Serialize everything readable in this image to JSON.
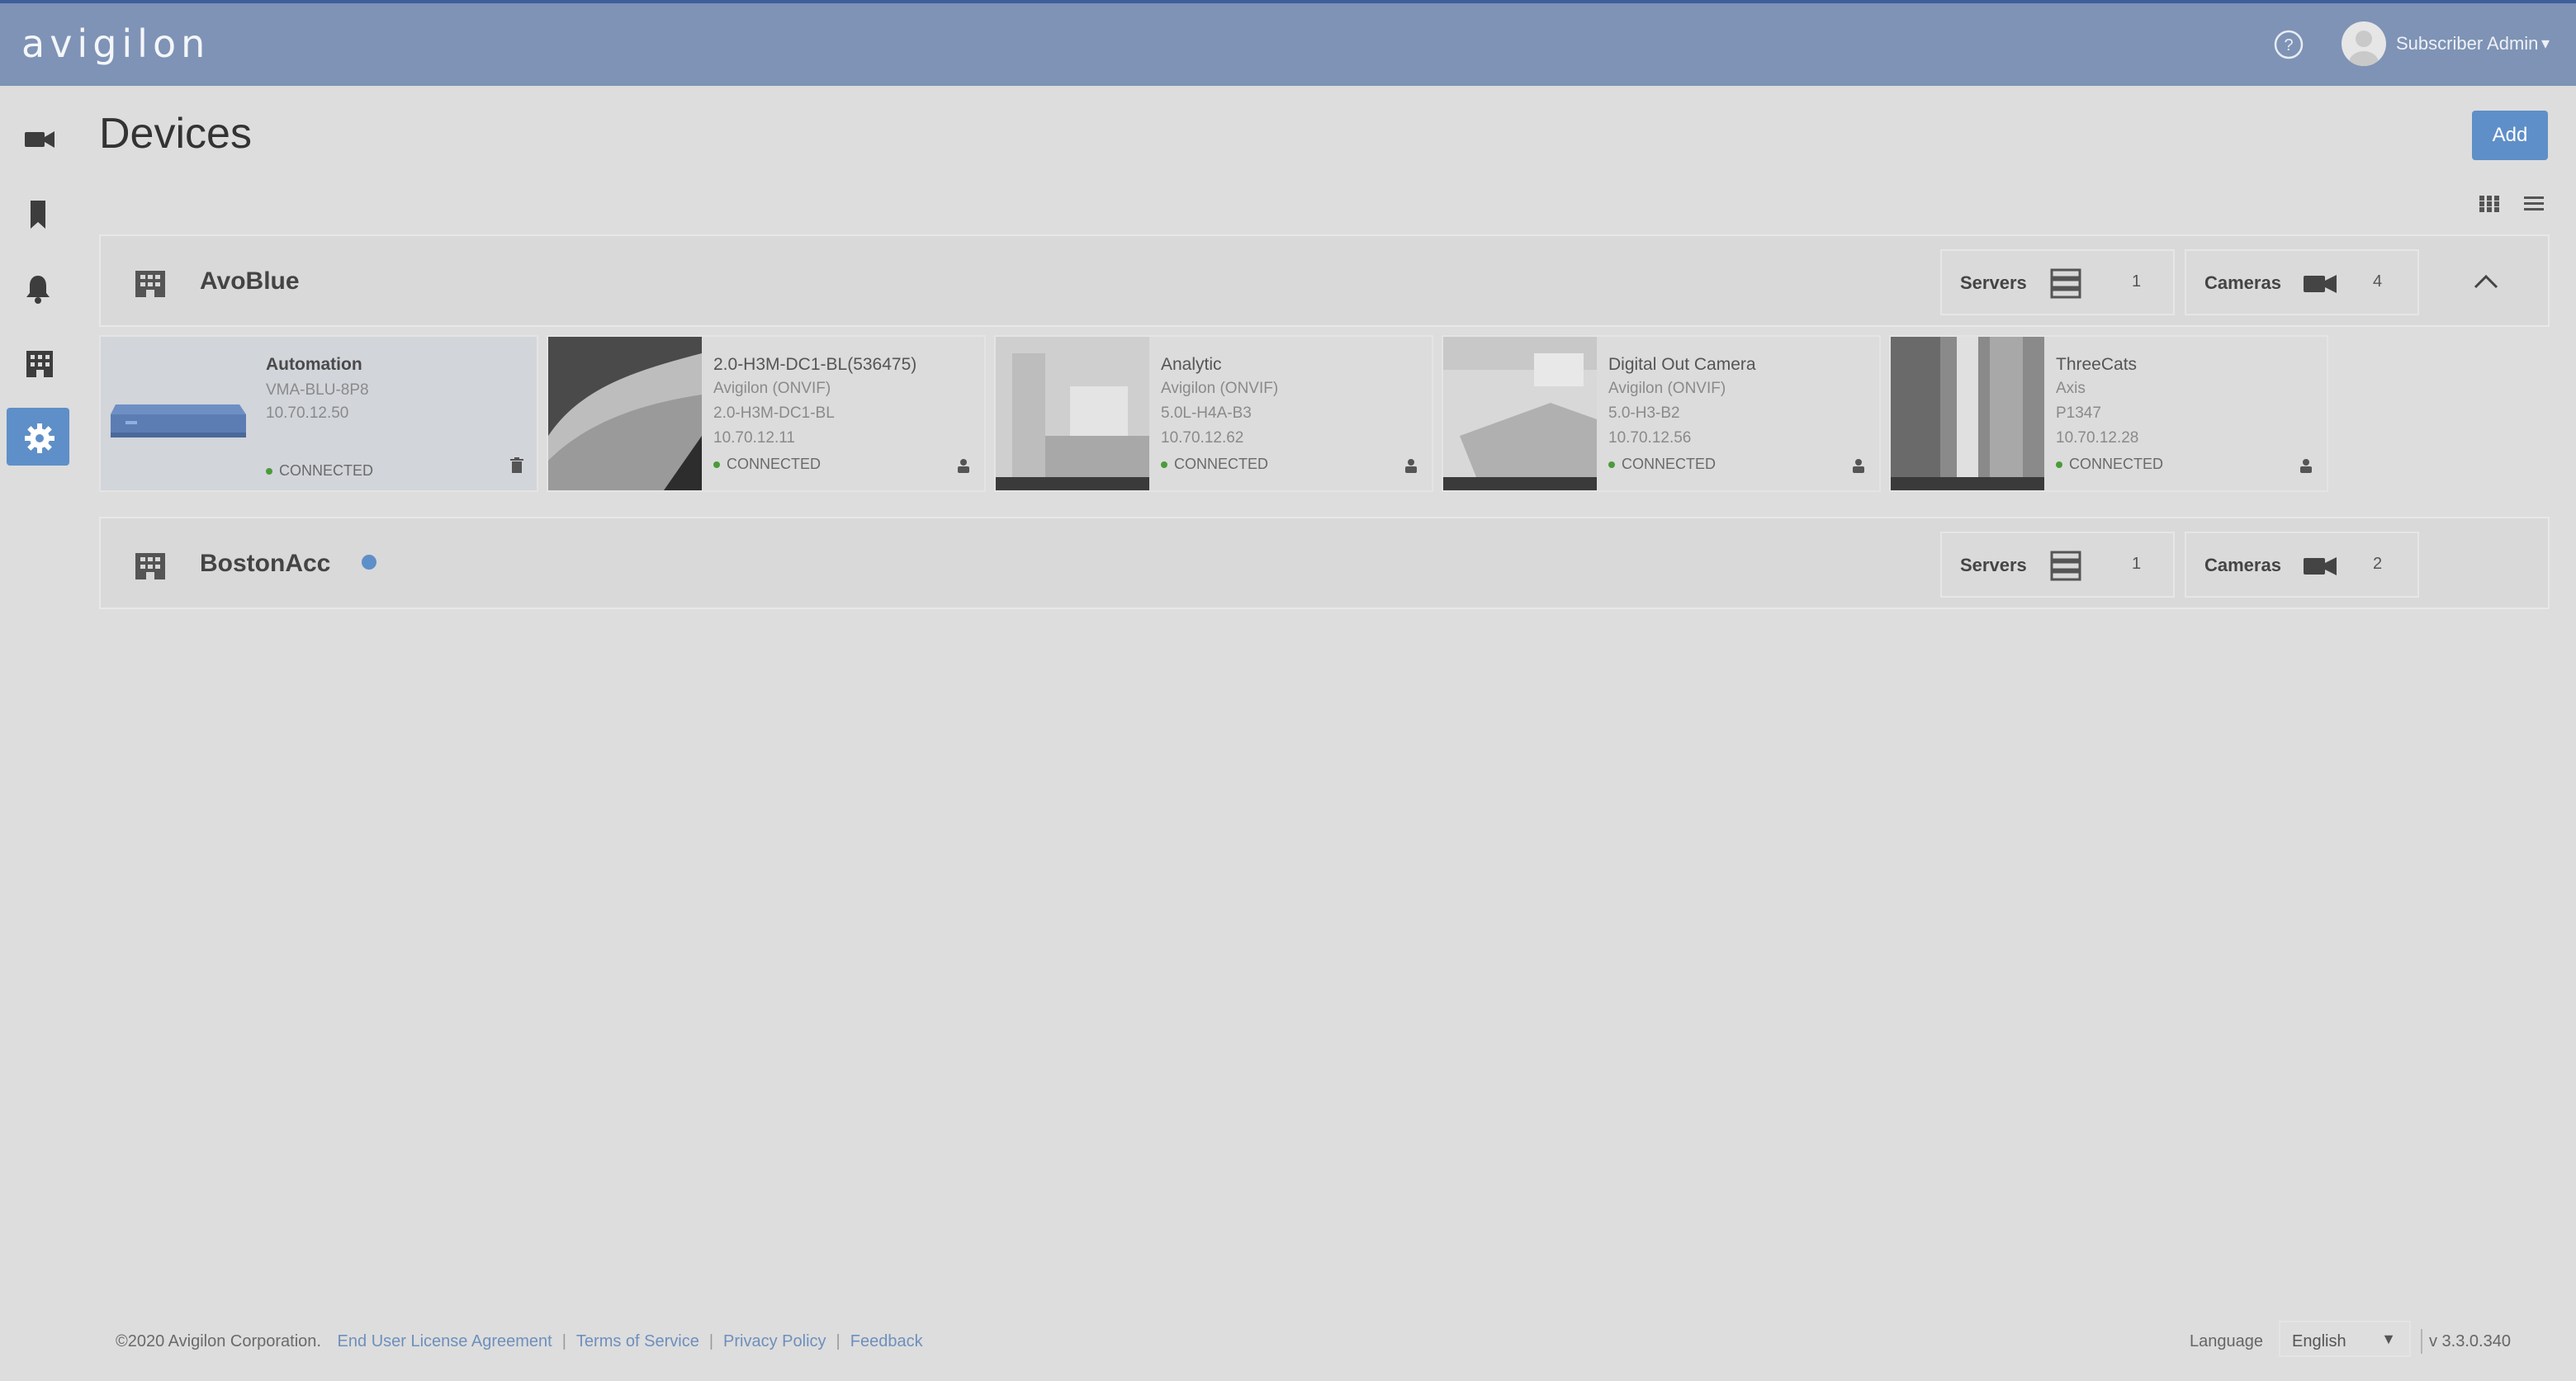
{
  "header": {
    "brand": "avigilon",
    "user_name": "Subscriber Admin",
    "user_caret": "▾"
  },
  "sidebar": {
    "items": [
      {
        "icon": "video-camera-icon"
      },
      {
        "icon": "bookmark-icon"
      },
      {
        "icon": "bell-icon"
      },
      {
        "icon": "building-icon"
      },
      {
        "icon": "gear-icon",
        "active": true
      }
    ]
  },
  "page": {
    "title": "Devices",
    "add_label": "Add"
  },
  "sites": [
    {
      "name": "AvoBlue",
      "servers_label": "Servers",
      "servers_count": "1",
      "cameras_label": "Cameras",
      "cameras_count": "4",
      "expanded": true,
      "devices": [
        {
          "name": "Automation",
          "line1": "VMA-BLU-8P8",
          "line2": "10.70.12.50",
          "line3": "",
          "status": "CONNECTED",
          "thumb": "server-appliance"
        },
        {
          "name": "2.0-H3M-DC1-BL(536475)",
          "line1": "Avigilon (ONVIF)",
          "line2": "2.0-H3M-DC1-BL",
          "line3": "10.70.12.11",
          "status": "CONNECTED",
          "thumb": "camera-view"
        },
        {
          "name": "Analytic",
          "line1": "Avigilon (ONVIF)",
          "line2": "5.0L-H4A-B3",
          "line3": "10.70.12.62",
          "status": "CONNECTED",
          "thumb": "camera-view"
        },
        {
          "name": "Digital Out Camera",
          "line1": "Avigilon (ONVIF)",
          "line2": "5.0-H3-B2",
          "line3": "10.70.12.56",
          "status": "CONNECTED",
          "thumb": "camera-view"
        },
        {
          "name": "ThreeCats",
          "line1": "Axis",
          "line2": "P1347",
          "line3": "10.70.12.28",
          "status": "CONNECTED",
          "thumb": "camera-view"
        }
      ]
    },
    {
      "name": "BostonAcc",
      "servers_label": "Servers",
      "servers_count": "1",
      "cameras_label": "Cameras",
      "cameras_count": "2",
      "expanded": false
    }
  ],
  "footer": {
    "copyright": "©2020 Avigilon Corporation.",
    "links": [
      "End User License Agreement",
      "Terms of Service",
      "Privacy Policy",
      "Feedback"
    ],
    "language_label": "Language",
    "language_value": "English",
    "version": "v 3.3.0.340"
  },
  "colors": {
    "header": "#7e93b5",
    "accent": "#5f8fc8",
    "connected": "#4a9c3b",
    "background": "#dddddd"
  }
}
